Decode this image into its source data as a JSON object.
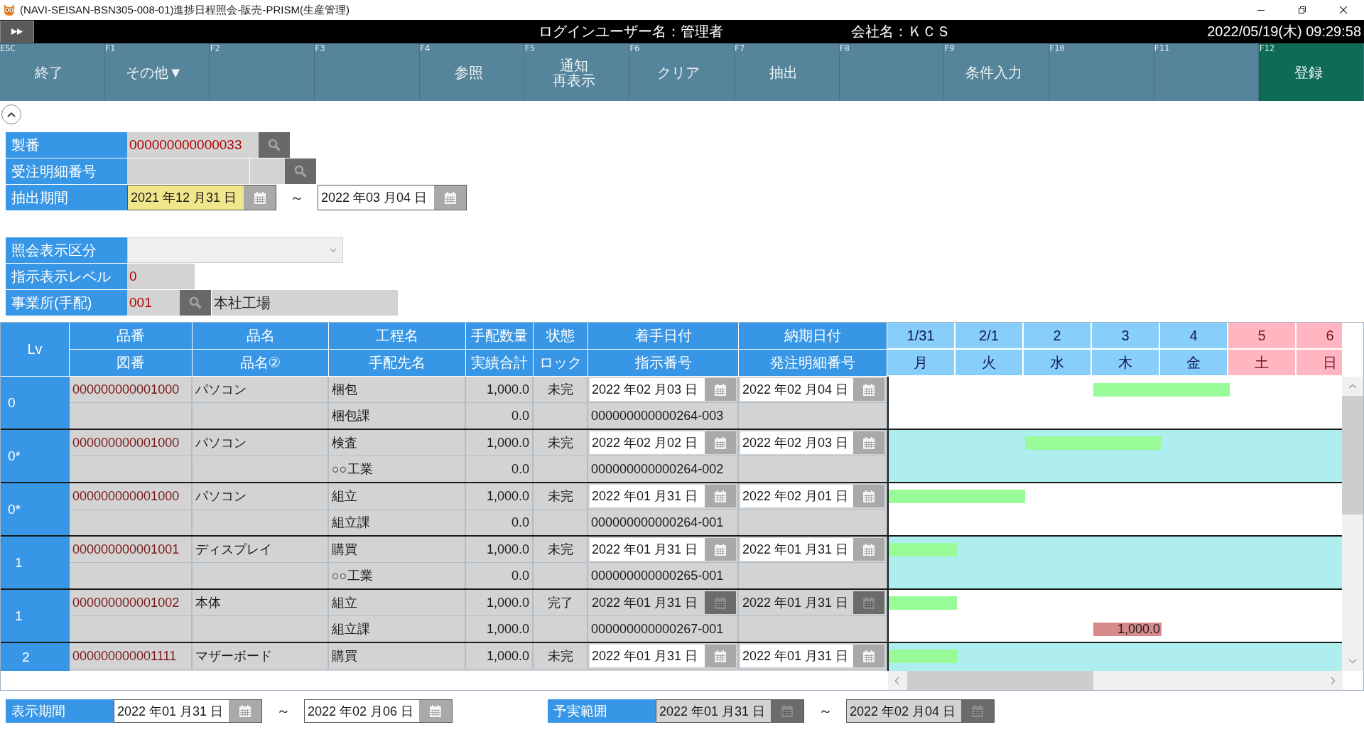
{
  "window": {
    "title": "(NAVI-SEISAN-BSN305-008-01)進捗日程照会-販売-PRISM(生産管理)"
  },
  "header": {
    "user": "ログインユーザー名：管理者",
    "company": "会社名：ＫＣＳ",
    "datetime": "2022/05/19(木) 09:29:58"
  },
  "function_keys": [
    {
      "key": "ESC",
      "lines": [
        "終了"
      ],
      "highlighted": false
    },
    {
      "key": "F1",
      "lines": [
        "その他▼"
      ],
      "highlighted": false
    },
    {
      "key": "F2",
      "highlighted": false
    },
    {
      "key": "F3",
      "highlighted": false
    },
    {
      "key": "F4",
      "lines": [
        "参照"
      ],
      "highlighted": false
    },
    {
      "key": "F5",
      "lines": [
        "通知",
        "再表示"
      ],
      "highlighted": false
    },
    {
      "key": "F6",
      "lines": [
        "クリア"
      ],
      "highlighted": false
    },
    {
      "key": "F7",
      "lines": [
        "抽出"
      ],
      "highlighted": false
    },
    {
      "key": "F8",
      "highlighted": false
    },
    {
      "key": "F9",
      "lines": [
        "条件入力"
      ],
      "highlighted": false
    },
    {
      "key": "F10",
      "highlighted": false
    },
    {
      "key": "F11",
      "highlighted": false
    },
    {
      "key": "F12",
      "lines": [
        "登録"
      ],
      "highlighted": true
    }
  ],
  "conditions": {
    "serial_no": {
      "label": "製番",
      "value": "000000000000033"
    },
    "order_detail_no": {
      "label": "受注明細番号"
    },
    "extract_period": {
      "label": "抽出期間",
      "from": {
        "value": "2021 年12 月31 日",
        "focused": true
      },
      "separator": "～",
      "to": {
        "value": "2022 年03 月04 日",
        "focused": false
      }
    },
    "display_type": {
      "label": "照会表示区分"
    },
    "instruction_level": {
      "label": "指示表示レベル",
      "value": "0"
    },
    "site": {
      "label": "事業所(手配)",
      "code": "001",
      "name": "本社工場"
    }
  },
  "table": {
    "lv_header": "Lv",
    "columns": [
      {
        "top": "品番",
        "bottom": "図番"
      },
      {
        "top": "品名",
        "bottom": "品名②"
      },
      {
        "top": "工程名",
        "bottom": "手配先名"
      },
      {
        "top": "手配数量",
        "bottom": "実績合計"
      },
      {
        "top": "状態",
        "bottom": "ロック"
      },
      {
        "top": "着手日付",
        "bottom": "指示番号"
      },
      {
        "top": "納期日付",
        "bottom": "発注明細番号"
      }
    ],
    "days": [
      {
        "date": "1/31",
        "weekday": "月",
        "holiday": false
      },
      {
        "date": "2/1",
        "weekday": "火",
        "holiday": false
      },
      {
        "date": "2",
        "weekday": "水",
        "holiday": false
      },
      {
        "date": "3",
        "weekday": "木",
        "holiday": false
      },
      {
        "date": "4",
        "weekday": "金",
        "holiday": false
      },
      {
        "date": "5",
        "weekday": "土",
        "holiday": true
      },
      {
        "date": "6",
        "weekday": "日",
        "holiday": true
      }
    ],
    "records": [
      {
        "lv": "0",
        "item_no": "000000000001000",
        "item_name": "パソコン",
        "process": "梱包",
        "qty": "1,000.0",
        "status": "未完",
        "start_date": "2022 年02 月03 日",
        "due_date": "2022 年02 月04 日",
        "supplier": "梱包課",
        "actual_total": "0.0",
        "instruction_no": "000000000000264-003",
        "disabled": false
      },
      {
        "lv": "0*",
        "item_no": "000000000001000",
        "item_name": "パソコン",
        "process": "検査",
        "qty": "1,000.0",
        "status": "未完",
        "start_date": "2022 年02 月02 日",
        "due_date": "2022 年02 月03 日",
        "supplier": "○○工業",
        "actual_total": "0.0",
        "instruction_no": "000000000000264-002",
        "disabled": false
      },
      {
        "lv": "0*",
        "item_no": "000000000001000",
        "item_name": "パソコン",
        "process": "組立",
        "qty": "1,000.0",
        "status": "未完",
        "start_date": "2022 年01 月31 日",
        "due_date": "2022 年02 月01 日",
        "supplier": "組立課",
        "actual_total": "0.0",
        "instruction_no": "000000000000264-001",
        "disabled": false,
        "children": [
          {
            "lv": "1",
            "item_no": "000000000001001",
            "item_name": "ディスプレイ",
            "process": "購買",
            "qty": "1,000.0",
            "status": "未完",
            "start_date": "2022 年01 月31 日",
            "due_date": "2022 年01 月31 日",
            "supplier": "○○工業",
            "actual_total": "0.0",
            "instruction_no": "000000000000265-001",
            "disabled": false
          },
          {
            "lv": "1",
            "item_no": "000000000001002",
            "item_name": "本体",
            "process": "組立",
            "qty": "1,000.0",
            "status": "完了",
            "start_date": "2022 年01 月31 日",
            "due_date": "2022 年01 月31 日",
            "supplier": "組立課",
            "actual_total": "1,000.0",
            "instruction_no": "000000000000267-001",
            "disabled": true,
            "actual_cells": [
              {
                "kind": "empty"
              },
              {
                "kind": "empty"
              },
              {
                "kind": "empty"
              },
              {
                "kind": "result",
                "amount": "1,000.0"
              },
              {
                "kind": "empty"
              },
              {
                "kind": "empty"
              },
              {
                "kind": "empty"
              }
            ],
            "children": [
              {
                "lv": "2",
                "item_no": "000000000001111",
                "item_name": "マザーボード",
                "process": "購買",
                "qty": "1,000.0",
                "status": "未完",
                "start_date": "2022 年01 月31 日",
                "due_date": "2022 年01 月31 日",
                "disabled": false
              }
            ]
          }
        ]
      }
    ]
  },
  "footer": {
    "display_period": {
      "label": "表示期間",
      "from": "2022 年01 月31 日",
      "separator": "～",
      "to": "2022 年02 月06 日",
      "disabled": false
    },
    "actual_range": {
      "label": "予実範囲",
      "from": "2022 年01 月31 日",
      "separator": "～",
      "to": "2022 年02 月04 日",
      "disabled": true
    }
  }
}
